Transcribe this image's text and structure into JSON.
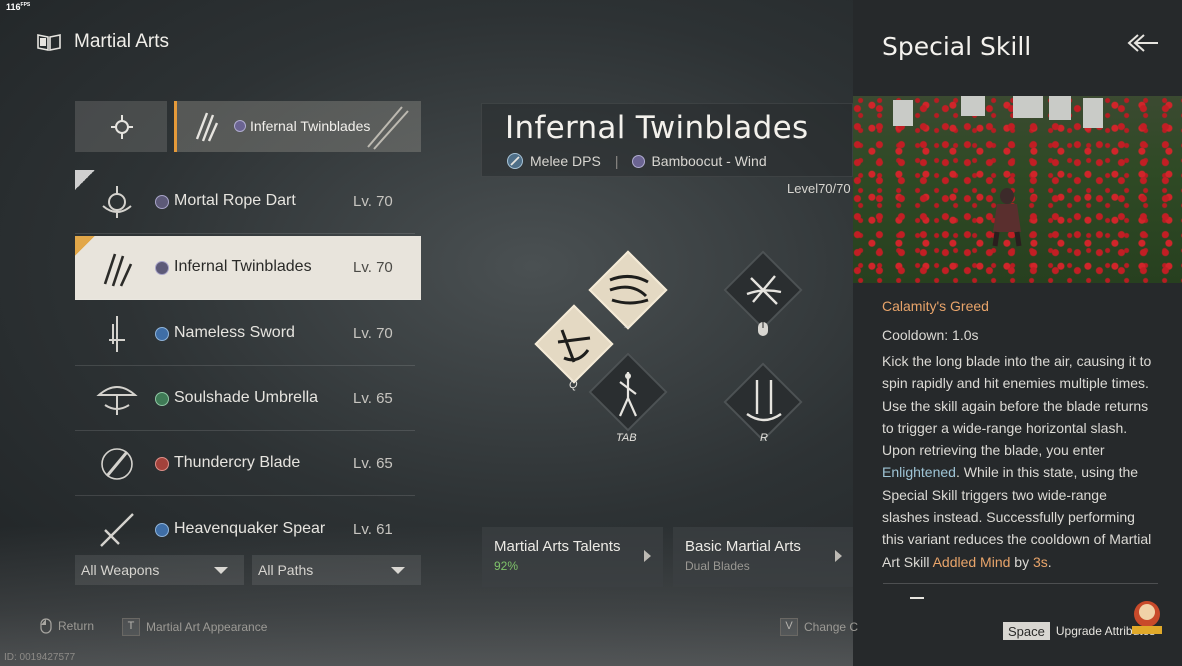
{
  "fps": "116",
  "fps_unit": "FPS",
  "header": {
    "title": "Martial Arts"
  },
  "selected": {
    "name": "Infernal Twinblades"
  },
  "weapons": [
    {
      "name": "Mortal Rope Dart",
      "level": "Lv. 70",
      "path_color": "#6b6492"
    },
    {
      "name": "Infernal Twinblades",
      "level": "Lv. 70",
      "path_color": "#6b6492"
    },
    {
      "name": "Nameless Sword",
      "level": "Lv. 70",
      "path_color": "#3f6ea6"
    },
    {
      "name": "Soulshade Umbrella",
      "level": "Lv. 65",
      "path_color": "#3f7a56"
    },
    {
      "name": "Thundercry Blade",
      "level": "Lv. 65",
      "path_color": "#a3423b"
    },
    {
      "name": "Heavenquaker Spear",
      "level": "Lv. 61",
      "path_color": "#3f6ea6"
    }
  ],
  "filters": {
    "weapons": "All Weapons",
    "paths": "All Paths"
  },
  "detail": {
    "weapon_name": "Infernal Twinblades",
    "role": "Melee DPS",
    "separator": "|",
    "path": "Bamboocut - Wind",
    "level": "Level70/70"
  },
  "skills": {
    "q": "Q",
    "tilde": "~",
    "tab": "TAB",
    "r": "R"
  },
  "cards": [
    {
      "title": "Martial Arts Talents",
      "sub": "92%",
      "sub_color": "#7fc36a"
    },
    {
      "title": "Basic Martial Arts",
      "sub": "Dual Blades",
      "sub_color": "#9a9893"
    }
  ],
  "panel": {
    "title": "Special Skill",
    "skill_name": "Calamity's Greed",
    "cooldown": "Cooldown: 1.0s",
    "desc_1": " Kick the long blade into the air, causing it to spin rapidly and hit enemies multiple times. Use the skill again before the blade returns to trigger a wide-range horizontal slash. Upon retrieving the blade, you enter ",
    "desc_hl_1": "Enlightened",
    "desc_2": ". While in this state, using the Special Skill triggers two wide-range slashes instead. Successfully performing this variant reduces the cooldown of Martial Art Skill ",
    "desc_hl_2": "Addled Mind",
    "desc_3": " by ",
    "desc_hl_3": "3s",
    "desc_4": "."
  },
  "footer": {
    "return": "Return",
    "appearance_key": "T",
    "appearance": "Martial Art Appearance",
    "change_key": "V",
    "change": "Change C",
    "space_key": "Space",
    "upgrade": "Upgrade Attributes",
    "id": "ID: 0019427577"
  },
  "colors": {
    "accent": "#e59a3a",
    "highlight_blue": "#9fc5d6",
    "highlight_gold": "#e8a46a"
  }
}
